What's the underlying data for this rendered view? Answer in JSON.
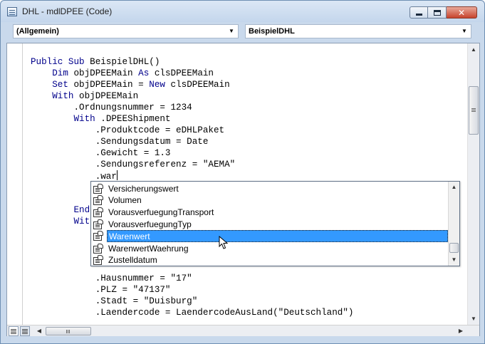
{
  "window": {
    "title": "DHL - mdlDPEE (Code)",
    "close_glyph": "✕"
  },
  "object_combo": {
    "value": "(Allgemein)"
  },
  "procedure_combo": {
    "value": "BeispielDHL"
  },
  "code_lines": [
    [
      {
        "k": true,
        "t": "Public Sub"
      },
      {
        "k": false,
        "t": " BeispielDHL()"
      }
    ],
    [
      {
        "k": false,
        "t": "    "
      },
      {
        "k": true,
        "t": "Dim"
      },
      {
        "k": false,
        "t": " objDPEEMain "
      },
      {
        "k": true,
        "t": "As"
      },
      {
        "k": false,
        "t": " clsDPEEMain"
      }
    ],
    [
      {
        "k": false,
        "t": "    "
      },
      {
        "k": true,
        "t": "Set"
      },
      {
        "k": false,
        "t": " objDPEEMain = "
      },
      {
        "k": true,
        "t": "New"
      },
      {
        "k": false,
        "t": " clsDPEEMain"
      }
    ],
    [
      {
        "k": false,
        "t": "    "
      },
      {
        "k": true,
        "t": "With"
      },
      {
        "k": false,
        "t": " objDPEEMain"
      }
    ],
    [
      {
        "k": false,
        "t": "        .Ordnungsnummer = 1234"
      }
    ],
    [
      {
        "k": false,
        "t": "        "
      },
      {
        "k": true,
        "t": "With"
      },
      {
        "k": false,
        "t": " .DPEEShipment"
      }
    ],
    [
      {
        "k": false,
        "t": "            .Produktcode = eDHLPaket"
      }
    ],
    [
      {
        "k": false,
        "t": "            .Sendungsdatum = Date"
      }
    ],
    [
      {
        "k": false,
        "t": "            .Gewicht = 1.3"
      }
    ],
    [
      {
        "k": false,
        "t": "            .Sendungsreferenz = \"AEMA\""
      }
    ],
    [
      {
        "k": false,
        "t": "            .war"
      }
    ],
    [
      {
        "k": false,
        "t": ""
      }
    ],
    [
      {
        "k": false,
        "t": ""
      }
    ],
    [
      {
        "k": false,
        "t": "        "
      },
      {
        "k": true,
        "t": "End"
      }
    ],
    [
      {
        "k": false,
        "t": "        "
      },
      {
        "k": true,
        "t": "With"
      }
    ],
    [
      {
        "k": false,
        "t": ""
      }
    ],
    [
      {
        "k": false,
        "t": ""
      }
    ],
    [
      {
        "k": false,
        "t": ""
      }
    ],
    [
      {
        "k": false,
        "t": ""
      }
    ],
    [
      {
        "k": false,
        "t": "            .Hausnummer = \"17\""
      }
    ],
    [
      {
        "k": false,
        "t": "            .PLZ = \"47137\""
      }
    ],
    [
      {
        "k": false,
        "t": "            .Stadt = \"Duisburg\""
      }
    ],
    [
      {
        "k": false,
        "t": "            .Laendercode = LaendercodeAusLand(\"Deutschland\")"
      }
    ]
  ],
  "intellisense": {
    "items": [
      {
        "label": "Versicherungswert",
        "selected": false
      },
      {
        "label": "Volumen",
        "selected": false
      },
      {
        "label": "VorausverfuegungTransport",
        "selected": false
      },
      {
        "label": "VorausverfuegungTyp",
        "selected": false
      },
      {
        "label": "Warenwert",
        "selected": true
      },
      {
        "label": "WarenwertWaehrung",
        "selected": false
      },
      {
        "label": "Zustelldatum",
        "selected": false
      }
    ],
    "selection_color": "#3399ff",
    "icon": "property-icon"
  },
  "colors": {
    "keyword": "#00008b",
    "title_bar": "#c9d9ec",
    "close_button": "#c7432d"
  }
}
